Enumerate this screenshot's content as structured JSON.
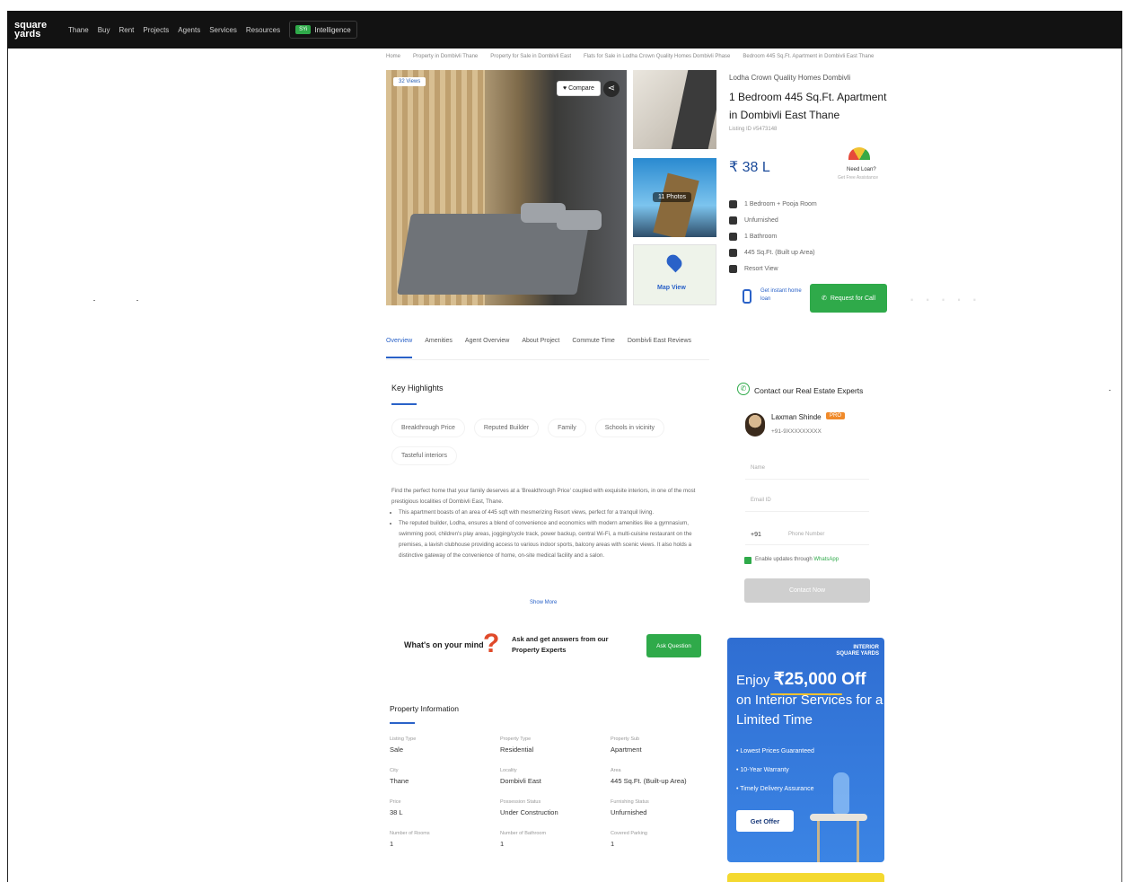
{
  "nav": {
    "logo": "square yards",
    "items": [
      "Thane",
      "Buy",
      "Rent",
      "Projects",
      "Agents",
      "Services",
      "Resources"
    ],
    "intel_badge": "SYi",
    "intel_label": "Intelligence"
  },
  "breadcrumb": [
    "Home",
    "Property in Dombivli Thane",
    "Property for Sale in Dombivli East",
    "Flats for Sale in Lodha Crown Quality Homes Dombivli Phase",
    "Bedroom 445 Sq.Ft. Apartment in Dombivli East Thane"
  ],
  "gallery": {
    "views_badge": "32 Views",
    "compare_label": "Compare",
    "share_icon": "share-icon",
    "photos_badge": "11 Photos",
    "map_label": "Map View"
  },
  "listing": {
    "project_name": "Lodha Crown Quality Homes Dombivli",
    "title": "1 Bedroom 445 Sq.Ft. Apartment in Dombivli East Thane",
    "listing_id": "Listing ID #5473148",
    "price": "₹ 38 L",
    "loan_label": "Need Loan?",
    "loan_sub": "Get Free Assistance",
    "specs": [
      {
        "icon": "bed-icon",
        "text": "1 Bedroom + Pooja Room"
      },
      {
        "icon": "sofa-icon",
        "text": "Unfurnished"
      },
      {
        "icon": "bath-icon",
        "text": "1 Bathroom"
      },
      {
        "icon": "area-icon",
        "text": "445 Sq.Ft. (Built up Area)"
      },
      {
        "icon": "view-icon",
        "text": "Resort View"
      }
    ],
    "instant_loan": "Get instant home loan",
    "call_label": "Request for Call"
  },
  "tabs": [
    "Overview",
    "Amenities",
    "Agent Overview",
    "About Project",
    "Commute Time",
    "Dombivli East Reviews"
  ],
  "highlights": {
    "title": "Key Highlights",
    "chips": [
      "Breakthrough Price",
      "Reputed Builder",
      "Family",
      "Schools in vicinity",
      "Tasteful interiors"
    ],
    "intro": "Find the perfect home that your family deserves at a 'Breakthrough Price' coupled with exquisite interiors, in one of the most prestigious localities of Dombivli East, Thane.",
    "bullets": [
      "This apartment boasts of an area of 445 sqft with mesmerizing Resort views, perfect for a tranquil living.",
      "The reputed builder, Lodha, ensures a blend of convenience and economics with modern amenities like a gymnasium, swimming pool, children's play areas, jogging/cycle track, power backup, central Wi-Fi, a multi-cuisine restaurant on the premises, a lavish clubhouse providing access to various indoor sports, balcony areas with scenic views. It also holds a distinctive gateway of the convenience of home, on-site medical facility and a salon."
    ],
    "show_more": "Show More"
  },
  "question": {
    "title": "What's on your mind",
    "mark": "?",
    "subtitle": "Ask and get answers from our Property Experts",
    "button": "Ask Question"
  },
  "property_info": {
    "title": "Property Information",
    "cells": [
      {
        "k": "Listing Type",
        "v": "Sale"
      },
      {
        "k": "Property Type",
        "v": "Residential"
      },
      {
        "k": "Property Sub",
        "v": "Apartment"
      },
      {
        "k": "City",
        "v": "Thane"
      },
      {
        "k": "Locality",
        "v": "Dombivli East"
      },
      {
        "k": "Area",
        "v": "445 Sq.Ft. (Built-up Area)"
      },
      {
        "k": "Price",
        "v": "38 L"
      },
      {
        "k": "Possession Status",
        "v": "Under Construction"
      },
      {
        "k": "Furnishing Status",
        "v": "Unfurnished"
      },
      {
        "k": "Number of Rooms",
        "v": "1"
      },
      {
        "k": "Number of Bathroom",
        "v": "1"
      },
      {
        "k": "Covered Parking",
        "v": "1"
      }
    ]
  },
  "contact": {
    "title": "Contact our Real Estate Experts",
    "agent_name": "Laxman Shinde",
    "agent_tag": "PRO",
    "agent_phone": "+91-9XXXXXXXXX",
    "name_placeholder": "Name",
    "email_placeholder": "Email ID",
    "country_code": "+91",
    "phone_placeholder": "Phone Number",
    "whatsapp_text": "Enable updates through",
    "whatsapp_brand": "WhatsApp",
    "button": "Contact Now"
  },
  "ad": {
    "brand": "INTERIOR",
    "brand_sub": "SQUARE YARDS",
    "head_pre": "Enjoy ",
    "head_amount": "₹25,000 Off",
    "head_post": " on Interior Services for a Limited Time",
    "points": [
      "Lowest Prices Guaranteed",
      "10-Year Warranty",
      "Timely Delivery Assurance"
    ],
    "button": "Get Offer"
  }
}
